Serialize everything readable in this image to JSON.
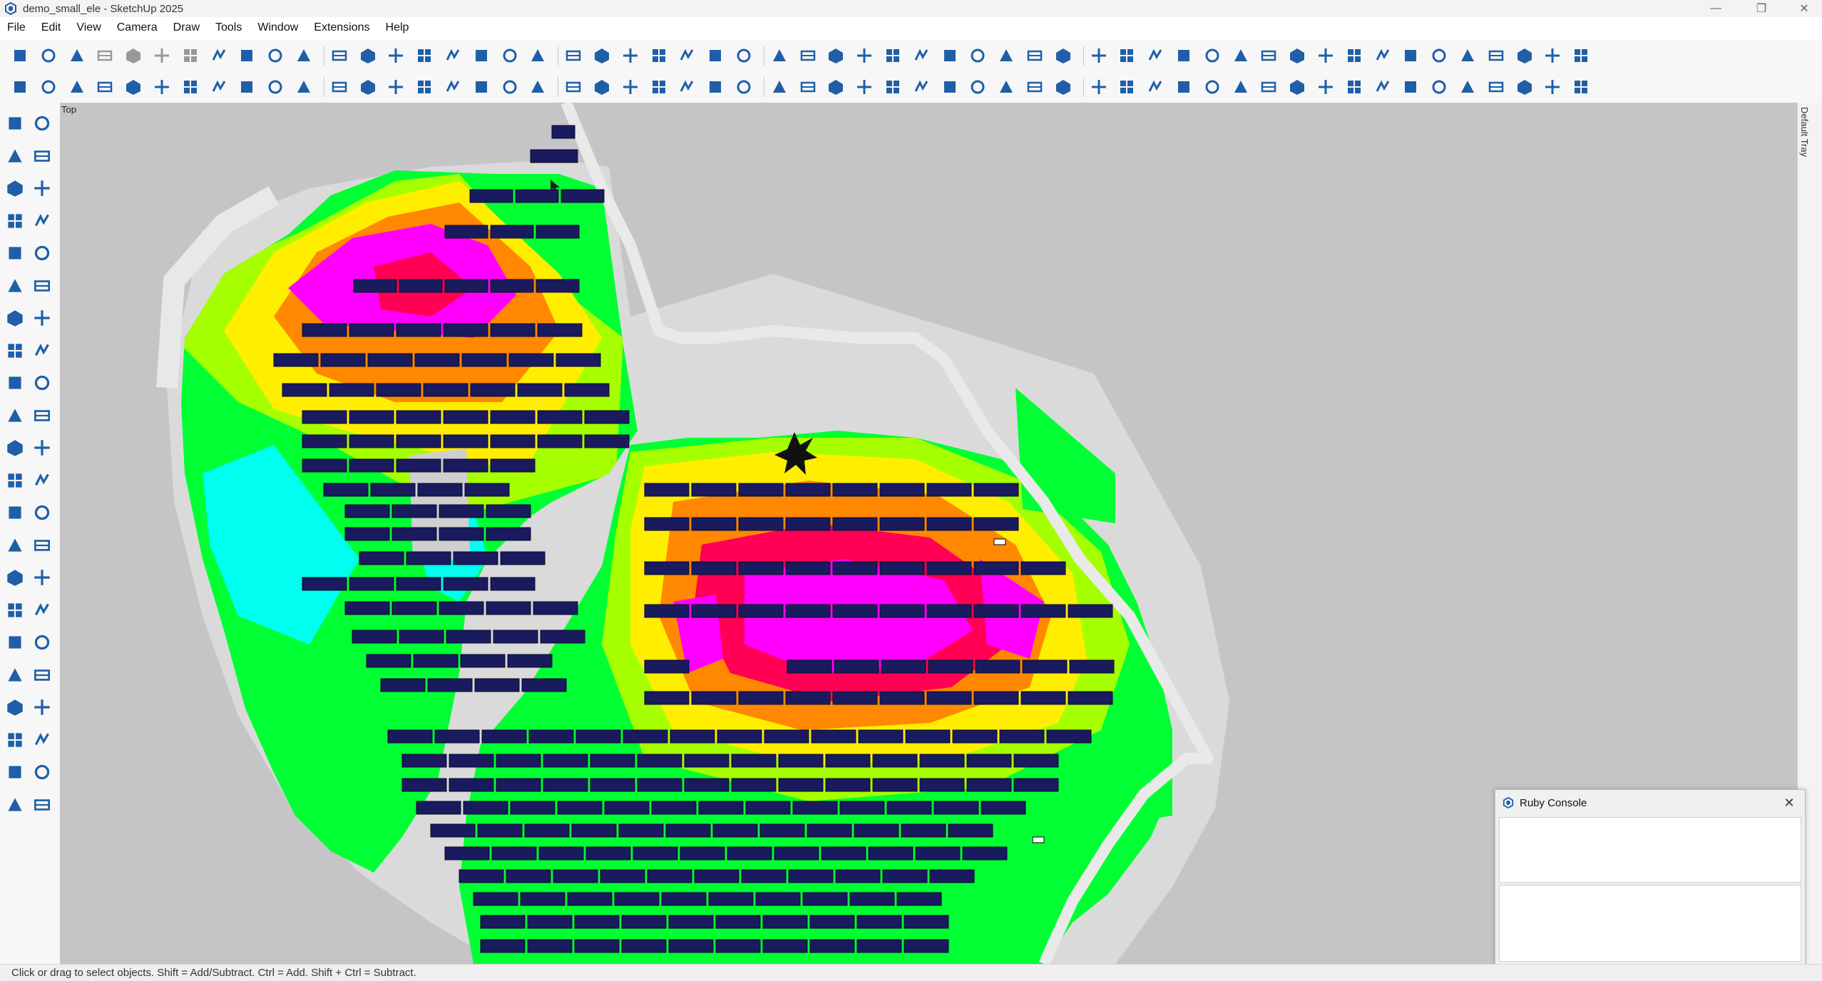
{
  "window": {
    "title": "demo_small_ele - SketchUp 2025",
    "controls": {
      "minimize": "—",
      "maximize": "❐",
      "close": "✕"
    }
  },
  "menu": [
    "File",
    "Edit",
    "View",
    "Camera",
    "Draw",
    "Tools",
    "Window",
    "Extensions",
    "Help"
  ],
  "toolbar_icons": {
    "row1": [
      "new-file-icon",
      "open-folder-icon",
      "save-icon",
      "cut-icon",
      "copy-icon",
      "paste-icon",
      "delete-icon",
      "undo-icon",
      "redo-icon",
      "print-icon",
      "model-info-icon",
      "iso-view-icon",
      "top-view-icon",
      "front-view-icon",
      "right-view-icon",
      "back-view-icon",
      "left-view-icon",
      "bottom-view-icon",
      "xray-style-icon",
      "back-edges-style-icon",
      "wireframe-style-icon",
      "hidden-line-style-icon",
      "shaded-style-icon",
      "shaded-textures-style-icon",
      "monochrome-style-icon",
      "ambient-occlusion-style-icon",
      "house-icon",
      "text-icon",
      "tower-icon",
      "pin-icon",
      "wind-turbine-icon",
      "solid-cube-icon",
      "grid-icon",
      "section-icon",
      "scale-arrow-icon",
      "hide-icon",
      "terrain-icon",
      "search-icon",
      "angle-icon",
      "dimension-icon",
      "measure-icon",
      "align-icon",
      "layers-list-icon",
      "lock-icon",
      "slope-icon",
      "pv-array-icon",
      "team-icon",
      "table-icon",
      "panel-icon",
      "snowflake-icon",
      "expand-icon",
      "auto-icon",
      "export-icon",
      "pattern-icon",
      "random-icon"
    ],
    "row2": [
      "menu-list-icon",
      "sun-icon",
      "globe-icon",
      "select-box-icon",
      "terrain-mesh-icon",
      "mountain-icon",
      "bar-icon",
      "skew-panel-icon",
      "panel-grid-icon",
      "flat-panel-icon",
      "bin-icon",
      "percent-icon",
      "spark-icon",
      "shadow-spark-icon",
      "cable-icon",
      "array-grid-icon",
      "module-icon",
      "spiral-icon",
      "zoom-target-icon",
      "wave-icon",
      "scan-icon",
      "anchor-icon",
      "chain-icon",
      "fence-icon",
      "node-icon",
      "box-icon",
      "plus-box-icon",
      "cloud-cad-icon",
      "ruler-icon",
      "tree-icon",
      "image-icon",
      "sheet-icon",
      "crosshair-icon",
      "table-grid-icon",
      "sliders-icon",
      "dropbox-icon",
      "sphere-icon",
      "yen-icon",
      "kwh-icon",
      "irr-icon",
      "report-icon",
      "gear-icon",
      "users-icon",
      "language-icon",
      "help-icon",
      "cloud-upload-icon",
      "refresh-icon",
      "database-icon",
      "loss-icon",
      "bi-icon",
      "play-icon",
      "close-pattern-icon",
      "tools-x-icon",
      "image-edit-icon",
      "doc-icon"
    ]
  },
  "left_toolbar_icons": [
    "select-arrow-icon",
    "lasso-select-icon",
    "paint-bucket-icon",
    "eraser-icon",
    "component-icon",
    "tag-icon",
    "pencil-icon",
    "freehand-icon",
    "rectangle-icon",
    "rotated-rectangle-icon",
    "circle-icon",
    "polygon-icon",
    "arc-icon",
    "pie-arc-icon",
    "two-point-arc-icon",
    "three-point-arc-icon",
    "move-icon",
    "push-pull-icon",
    "rotate-icon",
    "follow-me-icon",
    "scale-icon",
    "offset-icon",
    "axes-icon",
    "protractor-icon",
    "tape-measure-icon",
    "dimension-tool-icon",
    "curve-icon",
    "label-3d-icon",
    "orbit-icon",
    "text-3d-icon",
    "section-plane-icon",
    "pan-hand-icon",
    "zoom-icon",
    "zoom-window-icon",
    "zoom-extents-icon",
    "previous-view-icon",
    "walk-icon",
    "position-camera-icon",
    "look-around-icon",
    "view-cone-icon",
    "gear-settings-icon",
    "layer-x-icon",
    "layers-icon",
    "layers-x-icon"
  ],
  "viewport": {
    "view_label": "Top",
    "tray_label": "Default Tray"
  },
  "status": {
    "text": "Click or drag to select objects. Shift = Add/Subtract. Ctrl = Add. Shift + Ctrl = Subtract."
  },
  "ruby_console": {
    "title": "Ruby Console",
    "close": "✕"
  },
  "colors": {
    "accent_blue": "#1f5fa8",
    "ground": "#c5c5c8",
    "road": "#e6e6e6",
    "panel": "#1a1a5e",
    "heat": [
      "#ff00ff",
      "#ff0055",
      "#ff8800",
      "#ffee00",
      "#a6ff00",
      "#00ff33",
      "#00ffee"
    ]
  }
}
